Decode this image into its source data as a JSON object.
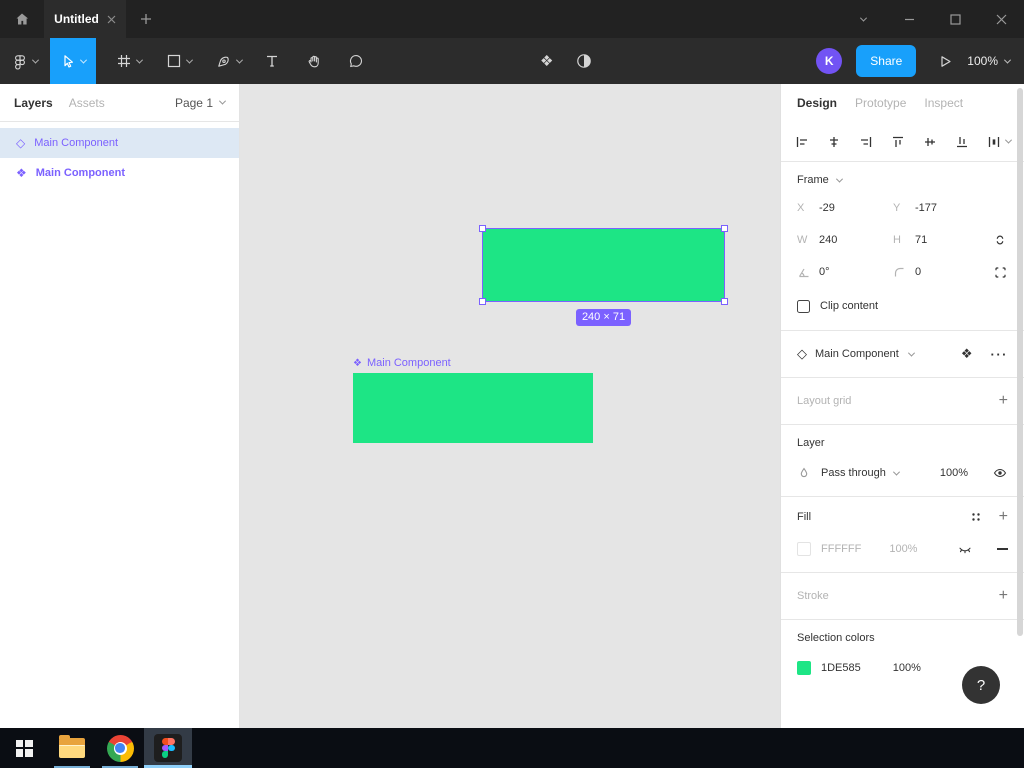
{
  "colors": {
    "accent_blue": "#18A0FB",
    "component_purple": "#7B61FF",
    "shape_green": "#1DE585",
    "avatar_purple": "#7253F4",
    "canvas_background": "#E5E5E5"
  },
  "titlebar": {
    "tab_title": "Untitled"
  },
  "toolbar": {
    "share": "Share",
    "avatar": "K",
    "zoom": "100%"
  },
  "left_sidebar": {
    "tab_layers": "Layers",
    "tab_assets": "Assets",
    "page": "Page 1",
    "layers": [
      {
        "name": "Main Component",
        "icon": "component-frame-diamond",
        "selected": true
      },
      {
        "name": "Main Component",
        "icon": "component-diamonds",
        "selected": false
      }
    ]
  },
  "canvas": {
    "dimension_label": "240 × 71",
    "component_label": "Main Component"
  },
  "right_panel": {
    "tab_design": "Design",
    "tab_prototype": "Prototype",
    "tab_inspect": "Inspect",
    "frame": {
      "title": "Frame",
      "x_label": "X",
      "x": "-29",
      "y_label": "Y",
      "y": "-177",
      "w_label": "W",
      "w": "240",
      "h_label": "H",
      "h": "71",
      "rotation": "0°",
      "radius": "0",
      "clip": "Clip content"
    },
    "component_name": "Main Component",
    "layout_grid": "Layout grid",
    "layer": {
      "title": "Layer",
      "blend": "Pass through",
      "opacity": "100%"
    },
    "fill": {
      "title": "Fill",
      "hex": "FFFFFF",
      "opacity": "100%"
    },
    "stroke": "Stroke",
    "selection_colors": {
      "title": "Selection colors",
      "hex": "1DE585",
      "opacity": "100%"
    },
    "help": "?"
  }
}
